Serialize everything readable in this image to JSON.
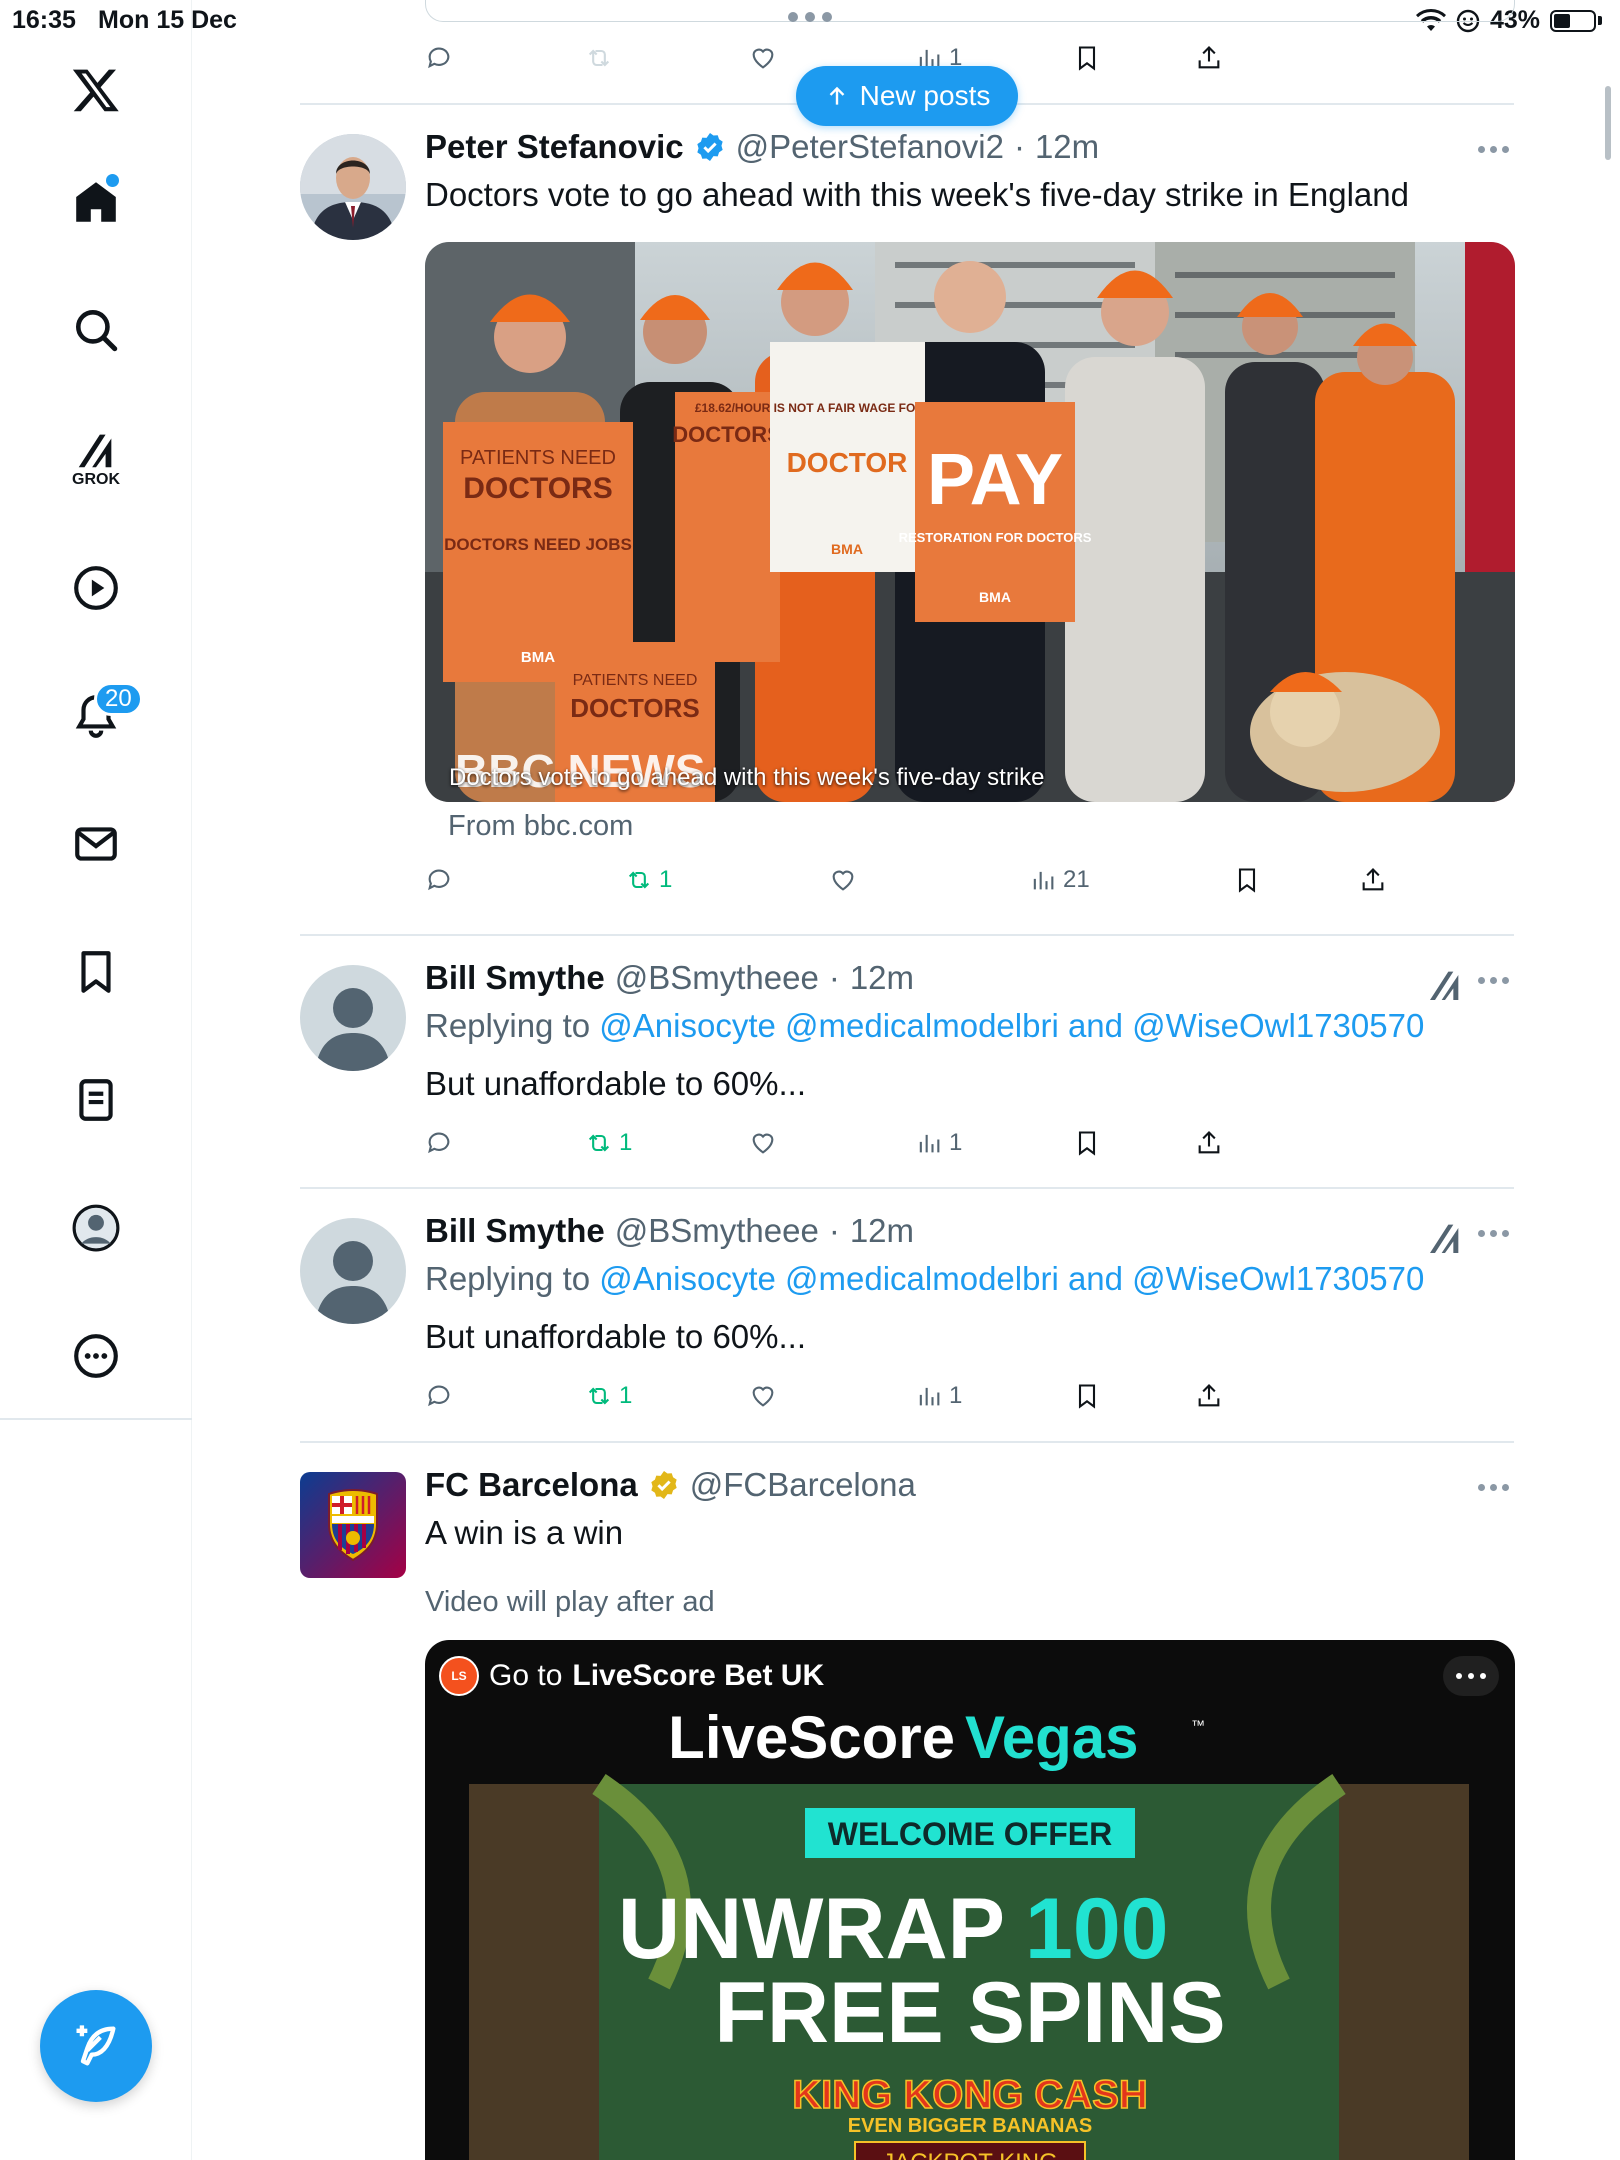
{
  "status_bar": {
    "time": "16:35",
    "date": "Mon 15 Dec",
    "battery": "43%"
  },
  "sidebar": {
    "grok_label": "GROK",
    "notifications_badge": "20"
  },
  "banner": {
    "new_posts": "New posts"
  },
  "top_tweet_actions": {
    "views": "1"
  },
  "tweets": [
    {
      "name": "Peter Stefanovic",
      "handle": "@PeterStefanovi2",
      "sep": "·",
      "time": "12m",
      "text": "Doctors vote to go ahead with this week's five-day strike in England",
      "card": {
        "image_caption": "Doctors vote to go ahead with this week's five-day strike",
        "watermark": "BBC NEWS",
        "sign_1_top": "PATIENTS NEED",
        "sign_1_mid": "DOCTORS",
        "sign_1_low": "DOCTORS NEED JOBS",
        "sign_2_top": "£18.62/HOUR IS NOT A FAIR WAGE FOR A RESIDENT",
        "sign_2_mid": "DOCTOR",
        "sign_3_big": "PAY",
        "sign_3_small": "RESTORATION FOR DOCTORS",
        "sign_logo": "BMA",
        "source": "From bbc.com"
      },
      "actions": {
        "retweets": "1",
        "views": "21"
      }
    },
    {
      "name": "Bill Smythe",
      "handle": "@BSmytheee",
      "sep": "·",
      "time": "12m",
      "replying_prefix": "Replying to",
      "replying_mentions": "@Anisocyte @medicalmodelbri and @WiseOwl1730570",
      "text": "But unaffordable to 60%...",
      "actions": {
        "retweets": "1",
        "views": "1"
      }
    },
    {
      "name": "Bill Smythe",
      "handle": "@BSmytheee",
      "sep": "·",
      "time": "12m",
      "replying_prefix": "Replying to",
      "replying_mentions": "@Anisocyte @medicalmodelbri and @WiseOwl1730570",
      "text": "But unaffordable to 60%...",
      "actions": {
        "retweets": "1",
        "views": "1"
      }
    },
    {
      "name": "FC Barcelona",
      "handle": "@FCBarcelona",
      "text": "A win is a win",
      "video_note": "Video will play after ad",
      "ad": {
        "logo_text": "LS",
        "header_prefix": "Go to",
        "header_brand": "LiveScore Bet UK",
        "brand_left": "LiveScore",
        "brand_right": "Vegas",
        "tm": "™",
        "offer_tag": "WELCOME OFFER",
        "headline_1a": "UNWRAP",
        "headline_1b": "100",
        "headline_2": "FREE SPINS",
        "game_title": "KING KONG CASH",
        "game_subtitle": "EVEN BIGGER BANANAS",
        "game_brand": "JACKPOT KING"
      }
    }
  ],
  "colors": {
    "accent": "#1d9bf0",
    "retweet": "#00ba7c",
    "muted": "#536471"
  }
}
